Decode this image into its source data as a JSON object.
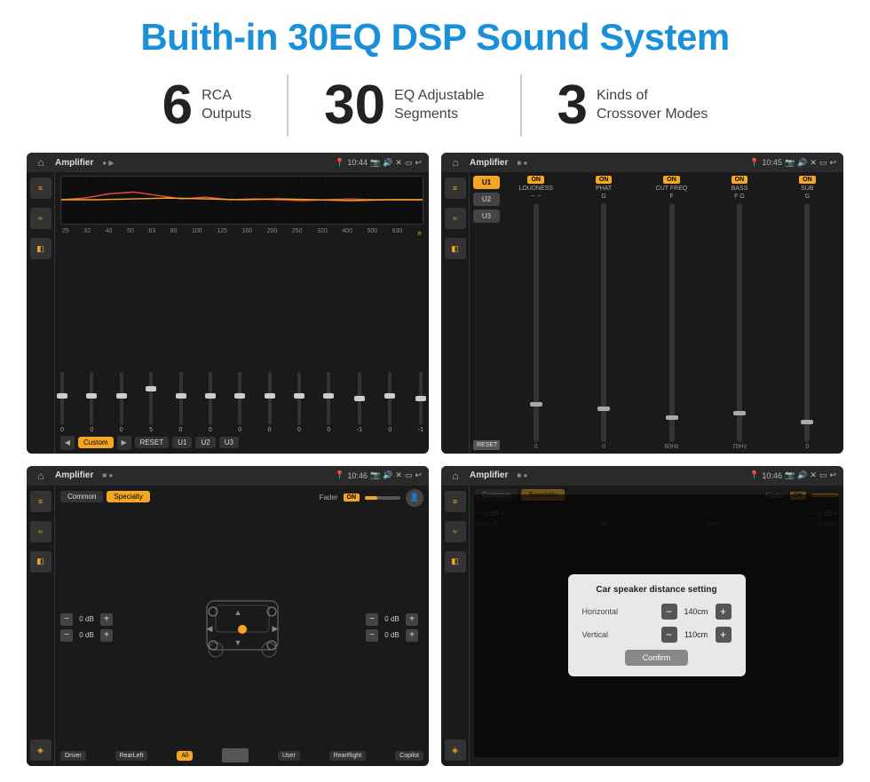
{
  "page": {
    "title": "Buith-in 30EQ DSP Sound System"
  },
  "stats": [
    {
      "number": "6",
      "label": "RCA\nOutputs"
    },
    {
      "number": "30",
      "label": "EQ Adjustable\nSegments"
    },
    {
      "number": "3",
      "label": "Kinds of\nCrossover Modes"
    }
  ],
  "screens": {
    "eq": {
      "title": "Amplifier",
      "time": "10:44",
      "freqs": [
        "25",
        "32",
        "40",
        "50",
        "63",
        "80",
        "100",
        "125",
        "160",
        "200",
        "250",
        "320",
        "400",
        "500",
        "630"
      ],
      "vals": [
        "0",
        "0",
        "0",
        "5",
        "0",
        "0",
        "0",
        "0",
        "0",
        "0",
        "-1",
        "0",
        "-1"
      ],
      "preset": "Custom",
      "buttons": [
        "RESET",
        "U1",
        "U2",
        "U3"
      ]
    },
    "crossover": {
      "title": "Amplifier",
      "time": "10:45",
      "presets": [
        "U1",
        "U2",
        "U3"
      ],
      "channels": [
        "LOUDNESS",
        "PHAT",
        "CUT FREQ",
        "BASS",
        "SUB"
      ]
    },
    "speaker": {
      "title": "Amplifier",
      "time": "10:46",
      "tabs": [
        "Common",
        "Specialty"
      ],
      "activeTab": "Specialty",
      "fader": "Fader",
      "faderOn": "ON",
      "controls": {
        "left": [
          "0 dB",
          "0 dB"
        ],
        "right": [
          "0 dB",
          "0 dB"
        ]
      },
      "bottomBtns": [
        "Driver",
        "RearLeft",
        "All",
        "User",
        "RearRight",
        "Copilot"
      ]
    },
    "distance": {
      "title": "Amplifier",
      "time": "10:46",
      "dialog": {
        "title": "Car speaker distance setting",
        "horizontal_label": "Horizontal",
        "horizontal_value": "140cm",
        "vertical_label": "Vertical",
        "vertical_value": "110cm",
        "confirm": "Confirm"
      }
    }
  }
}
